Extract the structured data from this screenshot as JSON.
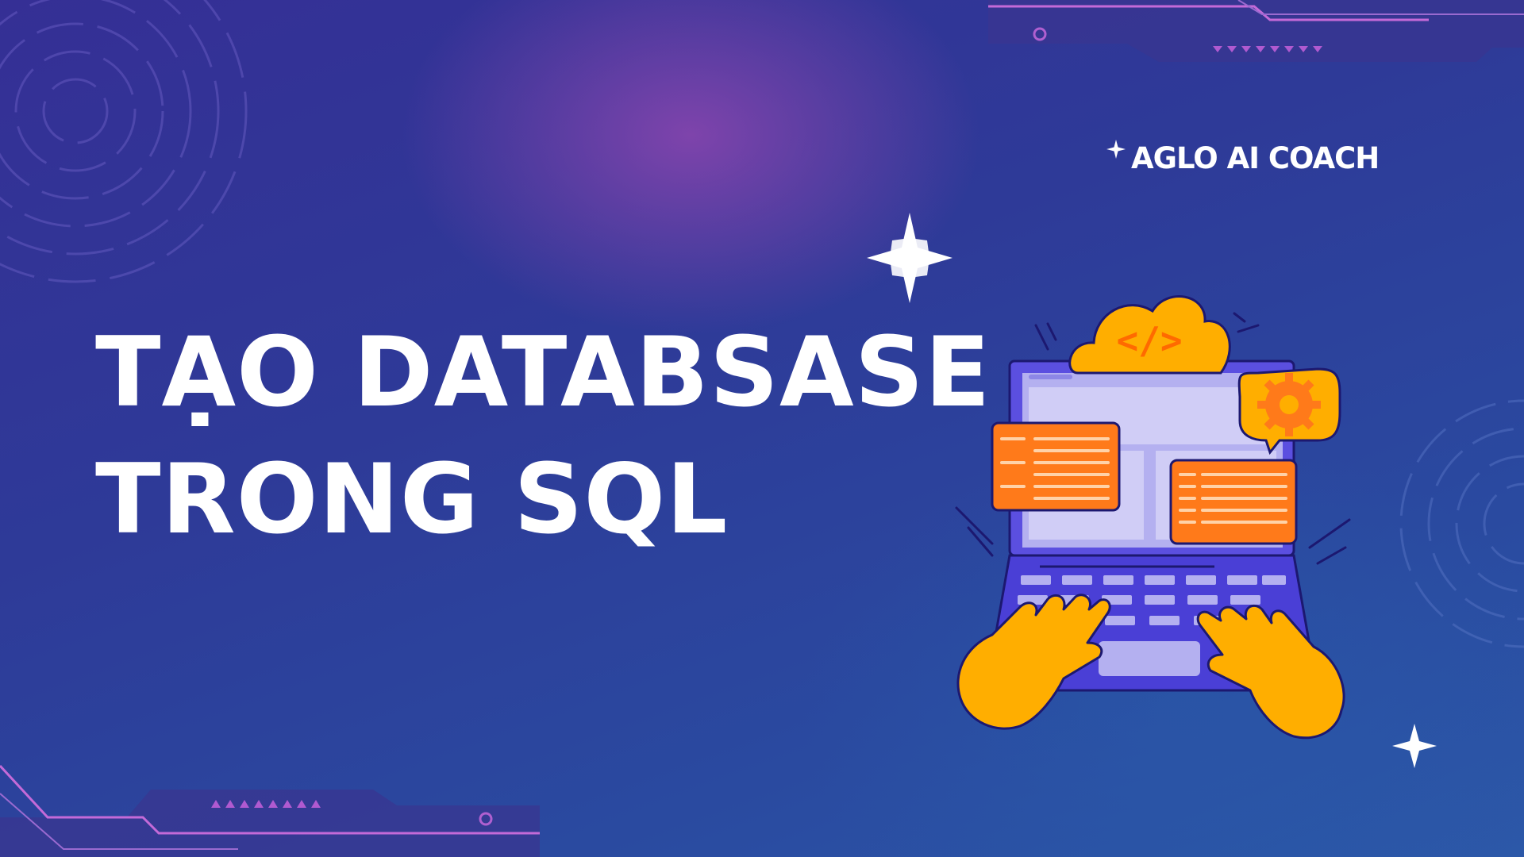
{
  "brand": {
    "name": "AGLO AI COACH",
    "icon": "sparkle-icon"
  },
  "headline": {
    "line1": "TẠO DATABSASE",
    "line2": "TRONG SQL"
  },
  "illustration": {
    "subject": "laptop-with-typing-hands",
    "cloud_code_label": "</>",
    "icons": [
      "cloud-code-icon",
      "gear-icon",
      "code-window-icon"
    ]
  },
  "colors": {
    "background": "#2e3a98",
    "glow": "#8c46af",
    "accent_orange": "#ff7a1a",
    "accent_yellow": "#ffae00",
    "laptop": "#5b4fe0",
    "screen": "#b4b0f0"
  }
}
